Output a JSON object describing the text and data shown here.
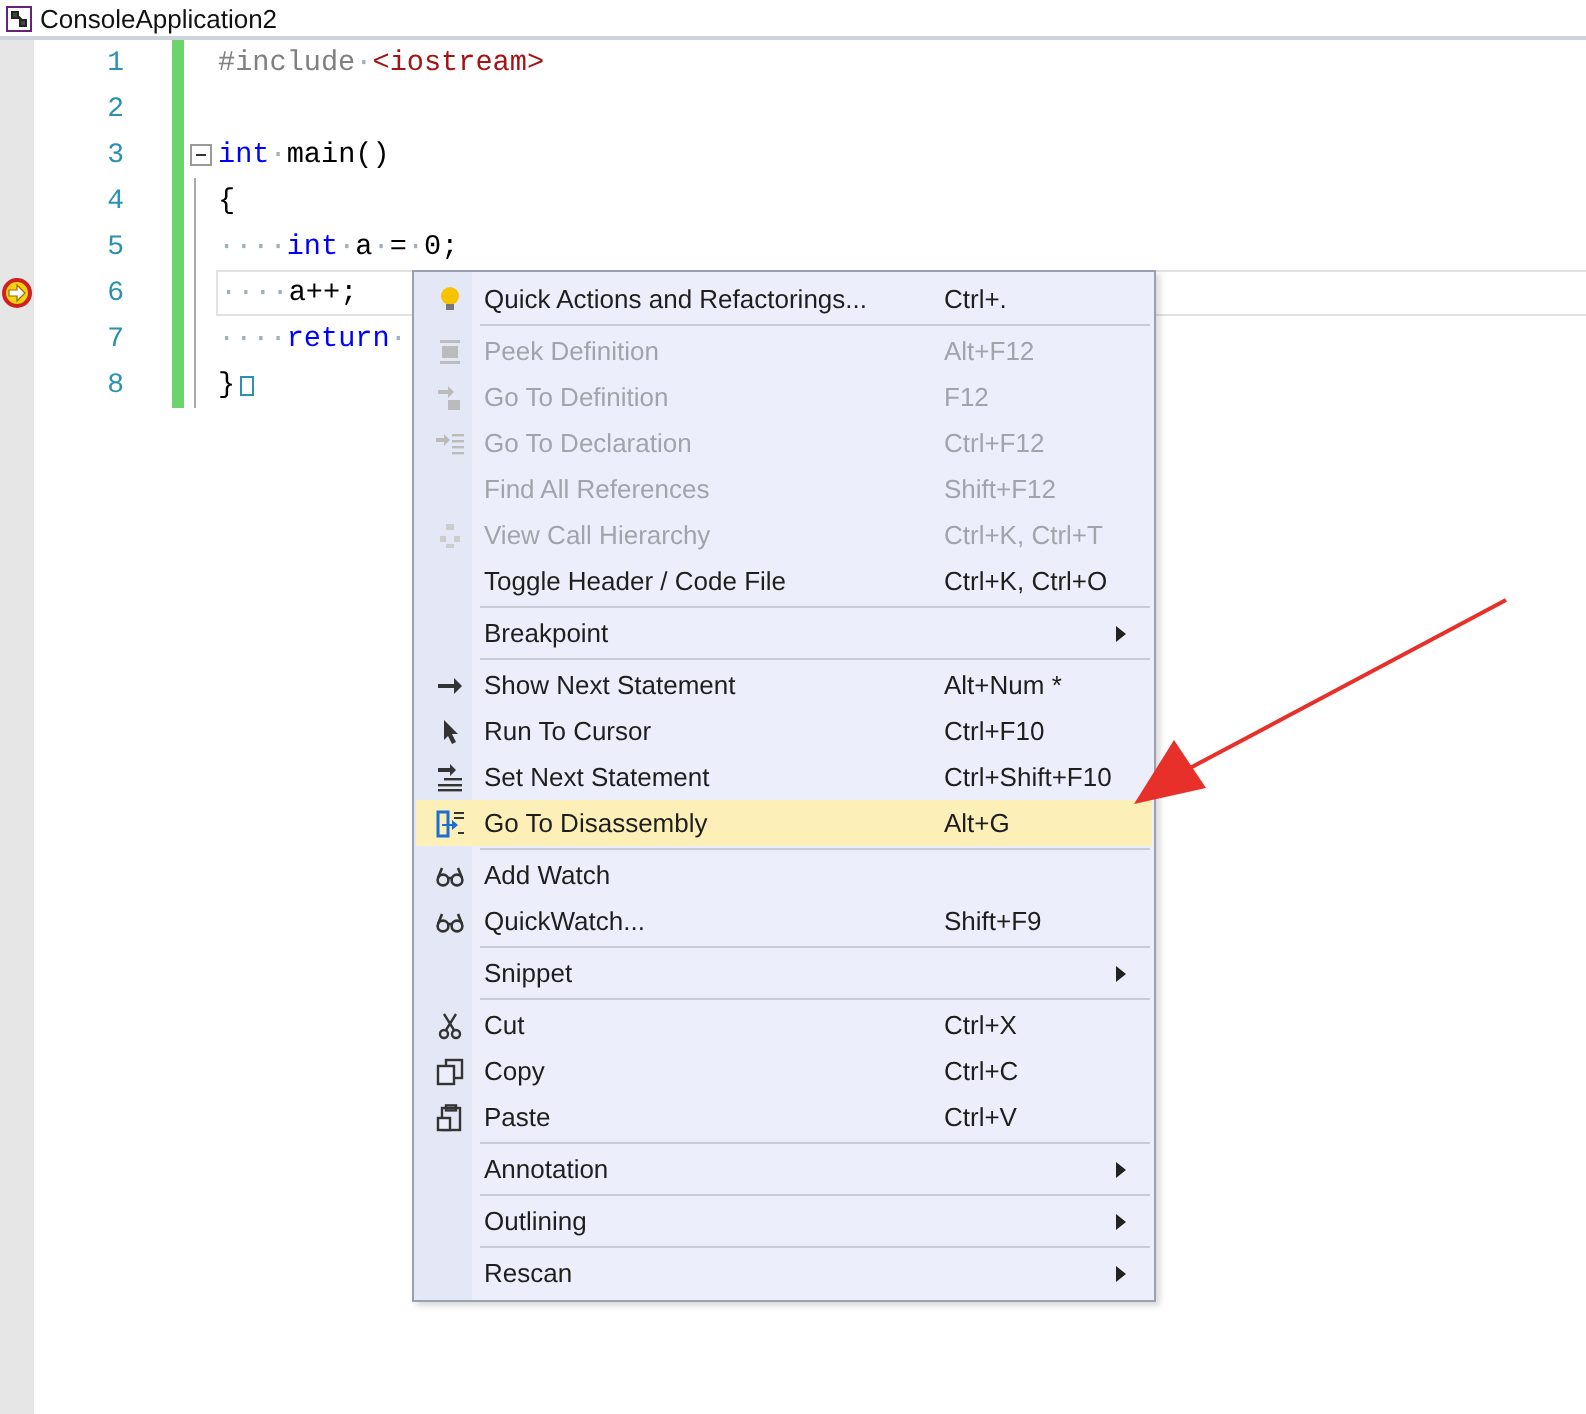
{
  "document_tab": {
    "title": "ConsoleApplication2"
  },
  "code_lines": [
    {
      "number": "1",
      "current": false,
      "fold": false,
      "tokens": [
        {
          "kind": "directive",
          "text": "#include"
        },
        {
          "kind": "ws",
          "text": "·"
        },
        {
          "kind": "string",
          "text": "<iostream>"
        }
      ]
    },
    {
      "number": "2",
      "current": false,
      "fold": false
    },
    {
      "number": "3",
      "current": false,
      "fold": true,
      "tokens": [
        {
          "kind": "keyword",
          "text": "int"
        },
        {
          "kind": "ws",
          "text": "·"
        },
        {
          "kind": "plain",
          "text": "main()"
        }
      ]
    },
    {
      "number": "4",
      "current": false,
      "fold": false,
      "tokens": [
        {
          "kind": "plain",
          "text": "{"
        }
      ]
    },
    {
      "number": "5",
      "current": false,
      "fold": false,
      "tokens": [
        {
          "kind": "ws",
          "text": "····"
        },
        {
          "kind": "keyword",
          "text": "int"
        },
        {
          "kind": "ws",
          "text": "·"
        },
        {
          "kind": "plain",
          "text": "a"
        },
        {
          "kind": "ws",
          "text": "·"
        },
        {
          "kind": "plain",
          "text": "="
        },
        {
          "kind": "ws",
          "text": "·"
        },
        {
          "kind": "plain",
          "text": "0;"
        }
      ]
    },
    {
      "number": "6",
      "current": true,
      "fold": false,
      "tokens": [
        {
          "kind": "ws",
          "text": "····"
        },
        {
          "kind": "plain",
          "text": "a++;"
        }
      ]
    },
    {
      "number": "7",
      "current": false,
      "fold": false,
      "tokens": [
        {
          "kind": "ws",
          "text": "····"
        },
        {
          "kind": "keyword",
          "text": "return"
        },
        {
          "kind": "ws",
          "text": "·"
        }
      ]
    },
    {
      "number": "8",
      "current": false,
      "fold": false,
      "tokens": [
        {
          "kind": "plain",
          "text": "}"
        }
      ]
    }
  ],
  "context_menu": {
    "items": [
      {
        "kind": "item",
        "label": "Quick Actions and Refactorings...",
        "shortcut": "Ctrl+.",
        "disabled": false,
        "selected": false,
        "submenu": false
      },
      {
        "kind": "separator"
      },
      {
        "kind": "item",
        "label": "Peek Definition",
        "shortcut": "Alt+F12",
        "disabled": true,
        "selected": false,
        "submenu": false
      },
      {
        "kind": "item",
        "label": "Go To Definition",
        "shortcut": "F12",
        "disabled": true,
        "selected": false,
        "submenu": false
      },
      {
        "kind": "item",
        "label": "Go To Declaration",
        "shortcut": "Ctrl+F12",
        "disabled": true,
        "selected": false,
        "submenu": false
      },
      {
        "kind": "item",
        "label": "Find All References",
        "shortcut": "Shift+F12",
        "disabled": true,
        "selected": false,
        "submenu": false
      },
      {
        "kind": "item",
        "label": "View Call Hierarchy",
        "shortcut": "Ctrl+K, Ctrl+T",
        "disabled": true,
        "selected": false,
        "submenu": false
      },
      {
        "kind": "item",
        "label": "Toggle Header / Code File",
        "shortcut": "Ctrl+K, Ctrl+O",
        "disabled": false,
        "selected": false,
        "submenu": false
      },
      {
        "kind": "separator"
      },
      {
        "kind": "item",
        "label": "Breakpoint",
        "disabled": false,
        "selected": false,
        "submenu": true
      },
      {
        "kind": "separator"
      },
      {
        "kind": "item",
        "label": "Show Next Statement",
        "shortcut": "Alt+Num *",
        "disabled": false,
        "selected": false,
        "submenu": false
      },
      {
        "kind": "item",
        "label": "Run To Cursor",
        "shortcut": "Ctrl+F10",
        "disabled": false,
        "selected": false,
        "submenu": false
      },
      {
        "kind": "item",
        "label": "Set Next Statement",
        "shortcut": "Ctrl+Shift+F10",
        "disabled": false,
        "selected": false,
        "submenu": false
      },
      {
        "kind": "item",
        "label": "Go To Disassembly",
        "shortcut": "Alt+G",
        "disabled": false,
        "selected": true,
        "submenu": false
      },
      {
        "kind": "separator"
      },
      {
        "kind": "item",
        "label": "Add Watch",
        "disabled": false,
        "selected": false,
        "submenu": false
      },
      {
        "kind": "item",
        "label": "QuickWatch...",
        "shortcut": "Shift+F9",
        "disabled": false,
        "selected": false,
        "submenu": false
      },
      {
        "kind": "separator"
      },
      {
        "kind": "item",
        "label": "Snippet",
        "disabled": false,
        "selected": false,
        "submenu": true
      },
      {
        "kind": "separator"
      },
      {
        "kind": "item",
        "label": "Cut",
        "shortcut": "Ctrl+X",
        "disabled": false,
        "selected": false,
        "submenu": false
      },
      {
        "kind": "item",
        "label": "Copy",
        "shortcut": "Ctrl+C",
        "disabled": false,
        "selected": false,
        "submenu": false
      },
      {
        "kind": "item",
        "label": "Paste",
        "shortcut": "Ctrl+V",
        "disabled": false,
        "selected": false,
        "submenu": false
      },
      {
        "kind": "separator"
      },
      {
        "kind": "item",
        "label": "Annotation",
        "disabled": false,
        "selected": false,
        "submenu": true
      },
      {
        "kind": "separator"
      },
      {
        "kind": "item",
        "label": "Outlining",
        "disabled": false,
        "selected": false,
        "submenu": true
      },
      {
        "kind": "separator"
      },
      {
        "kind": "item",
        "label": "Rescan",
        "disabled": false,
        "selected": false,
        "submenu": true
      }
    ]
  }
}
